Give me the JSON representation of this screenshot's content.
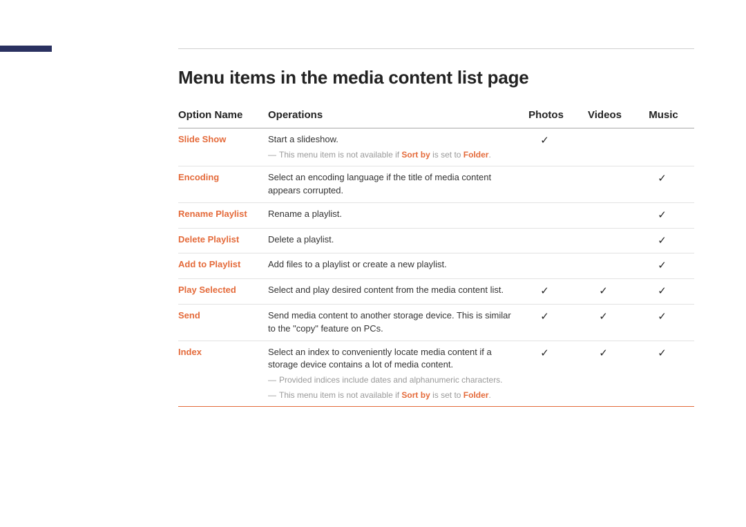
{
  "title": "Menu items in the media content list page",
  "headers": {
    "option": "Option Name",
    "ops": "Operations",
    "photos": "Photos",
    "videos": "Videos",
    "music": "Music"
  },
  "checkmark": "✓",
  "rows": [
    {
      "option": "Slide Show",
      "ops": "Start a slideshow.",
      "notes": [
        {
          "plain": "This menu item is not available if ",
          "hl1": "Sort by",
          "mid": " is set to ",
          "hl2": "Folder",
          "tail": "."
        }
      ],
      "photos": true,
      "videos": false,
      "music": false
    },
    {
      "option": "Encoding",
      "ops": "Select an encoding language if the title of media content appears corrupted.",
      "notes": [],
      "photos": false,
      "videos": false,
      "music": true
    },
    {
      "option": "Rename Playlist",
      "ops": "Rename a playlist.",
      "notes": [],
      "photos": false,
      "videos": false,
      "music": true
    },
    {
      "option": "Delete Playlist",
      "ops": "Delete a playlist.",
      "notes": [],
      "photos": false,
      "videos": false,
      "music": true
    },
    {
      "option": "Add to Playlist",
      "ops": "Add files to a playlist or create a new playlist.",
      "notes": [],
      "photos": false,
      "videos": false,
      "music": true
    },
    {
      "option": "Play Selected",
      "ops": "Select and play desired content from the media content list.",
      "notes": [],
      "photos": true,
      "videos": true,
      "music": true
    },
    {
      "option": "Send",
      "ops": "Send media content to another storage device. This is similar to the \"copy\" feature on PCs.",
      "notes": [],
      "photos": true,
      "videos": true,
      "music": true
    },
    {
      "option": "Index",
      "ops": "Select an index to conveniently locate media content if a storage device contains a lot of media content.",
      "notes": [
        {
          "plain": "Provided indices include dates and alphanumeric characters.",
          "hl1": "",
          "mid": "",
          "hl2": "",
          "tail": ""
        },
        {
          "plain": "This menu item is not available if ",
          "hl1": "Sort by",
          "mid": " is set to ",
          "hl2": "Folder",
          "tail": "."
        }
      ],
      "photos": true,
      "videos": true,
      "music": true
    }
  ]
}
